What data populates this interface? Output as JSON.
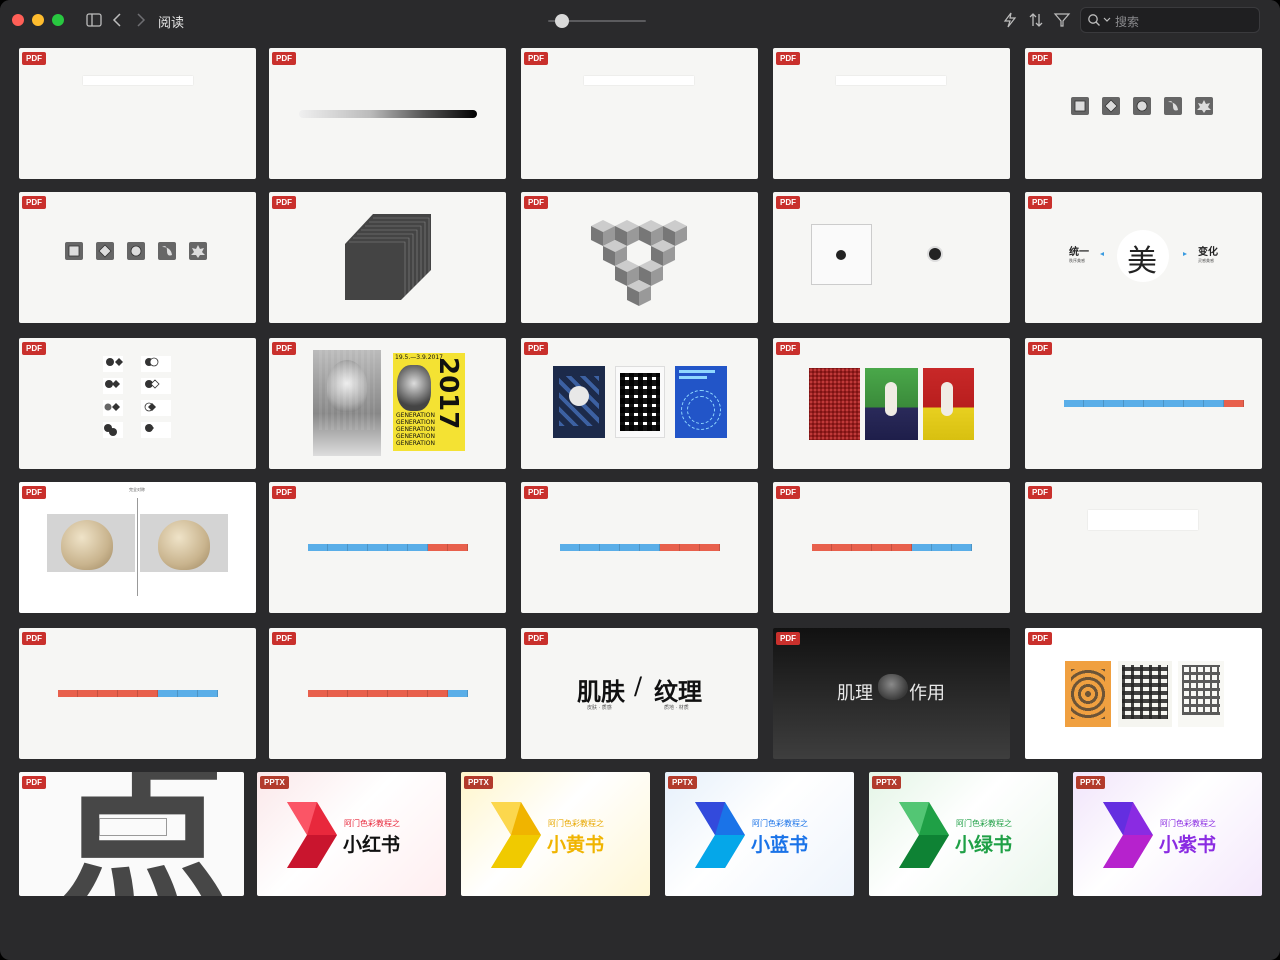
{
  "window": {
    "title": "阅读",
    "search_placeholder": "搜索",
    "zoom_level": 0.15
  },
  "toolbar": {
    "sidebar_icon": "sidebar-icon",
    "back_icon": "chevron-left-icon",
    "forward_icon": "chevron-right-icon",
    "icons": [
      "lightning-icon",
      "sort-icon",
      "filter-icon",
      "search-icon"
    ]
  },
  "badges": {
    "pdf": "PDF",
    "pptx": "PPTX"
  },
  "slides": {
    "s10": {
      "left_title": "统一",
      "left_sub": "秩序美感",
      "center": "美",
      "right_title": "变化",
      "right_sub": "灵感美感"
    },
    "s23": {
      "left": "肌肤",
      "slash": "/",
      "right": "纹理",
      "left_sub": "皮肤 · 质感",
      "right_sub": "质地 · 材质"
    },
    "s24": {
      "left": "肌理",
      "right": "作用"
    },
    "s26": {
      "subtitle": "阿门色彩教程之",
      "title": "小红书"
    },
    "s27": {
      "subtitle": "阿门色彩教程之",
      "title": "小黄书"
    },
    "s28": {
      "subtitle": "阿门色彩教程之",
      "title": "小蓝书"
    },
    "s29": {
      "subtitle": "阿门色彩教程之",
      "title": "小绿书"
    },
    "s30": {
      "subtitle": "阿门色彩教程之",
      "title": "小紫书"
    },
    "s25": {
      "big_char": "点"
    },
    "s12": {
      "date": "19.5.—3.9.2017",
      "year": "2017",
      "words": "GENERATION"
    },
    "s16": {
      "title": "完全对称"
    }
  },
  "colors": {
    "window_bg": "#2a2a2c",
    "pdf_badge": "#c9302c",
    "pptx_badge": "#b23b2c",
    "blue_seg": "#5aaee8",
    "red_seg": "#e8604c",
    "red_book": "#e8283c",
    "yellow_book": "#f0b400",
    "blue_book": "#1a73e8",
    "green_book": "#1fa046",
    "purple_book": "#8a2be2"
  }
}
